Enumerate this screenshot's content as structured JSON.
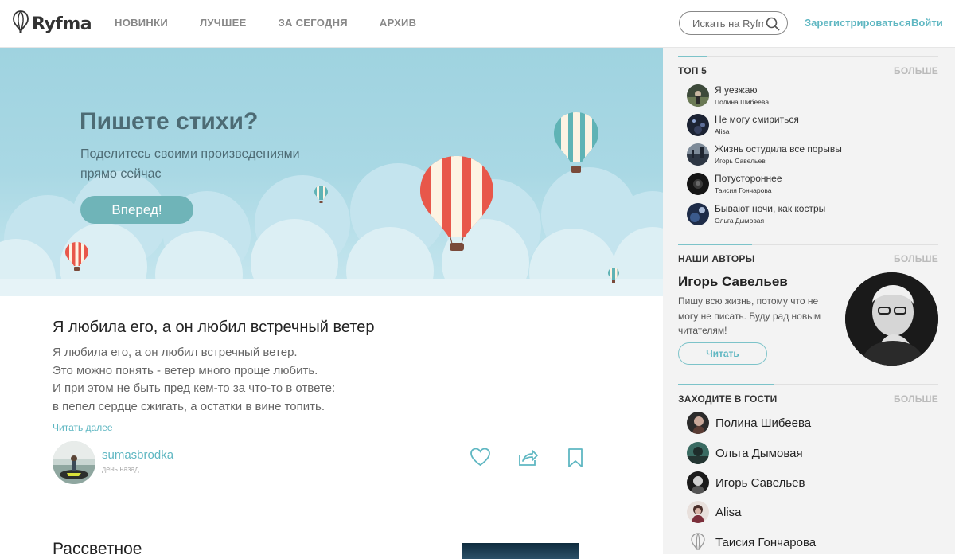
{
  "header": {
    "logo_text": "Ryfma",
    "nav": [
      "НОВИНКИ",
      "ЛУЧШЕЕ",
      "ЗА СЕГОДНЯ",
      "АРХИВ"
    ],
    "search_placeholder": "Искать на Ryfma",
    "register_label": "Зарегистрироваться",
    "login_label": "Войти"
  },
  "hero": {
    "title": "Пишете стихи?",
    "subtitle": "Поделитесь своими произведениями прямо сейчас",
    "button_label": "Вперед!"
  },
  "post": {
    "title": "Я любила его, а он любил встречный ветер",
    "lines": [
      "Я любила его, а он любил встречный ветер.",
      "Это можно понять - ветер много проще любить.",
      "И при этом не быть пред кем-то за что-то в ответе:",
      "в пепел сердце сжигать, а остатки в вине топить."
    ],
    "read_more": "Читать далее",
    "author": "sumasbrodka",
    "time": "день назад"
  },
  "next_post": {
    "title": "Рассветное"
  },
  "sidebar": {
    "top5": {
      "title": "ТОП 5",
      "more": "БОЛЬШЕ",
      "items": [
        {
          "title": "Я уезжаю",
          "author": "Полина Шибеева"
        },
        {
          "title": "Не могу смириться",
          "author": "Alisa"
        },
        {
          "title": "Жизнь остудила все порывы",
          "author": "Игорь Савельев"
        },
        {
          "title": "Потустороннее",
          "author": "Таисия Гончарова"
        },
        {
          "title": "Бывают ночи, как костры",
          "author": "Ольга Дымовая"
        }
      ]
    },
    "authors": {
      "title": "НАШИ АВТОРЫ",
      "more": "БОЛЬШЕ",
      "name": "Игорь Савельев",
      "bio": "Пишу всю жизнь, потому что не могу не писать. Буду рад новым читателям!",
      "button_label": "Читать"
    },
    "guests": {
      "title": "ЗАХОДИТЕ В ГОСТИ",
      "more": "БОЛЬШЕ",
      "items": [
        "Полина Шибеева",
        "Ольга Дымовая",
        "Игорь Савельев",
        "Alisa",
        "Таисия Гончарова"
      ]
    }
  },
  "colors": {
    "accent": "#5fb7c2",
    "hero_button": "#6fb4b8",
    "sidebar_bg": "#f3f3f3"
  },
  "icons": [
    "balloon-logo-icon",
    "search-icon",
    "heart-icon",
    "share-icon",
    "bookmark-icon"
  ]
}
